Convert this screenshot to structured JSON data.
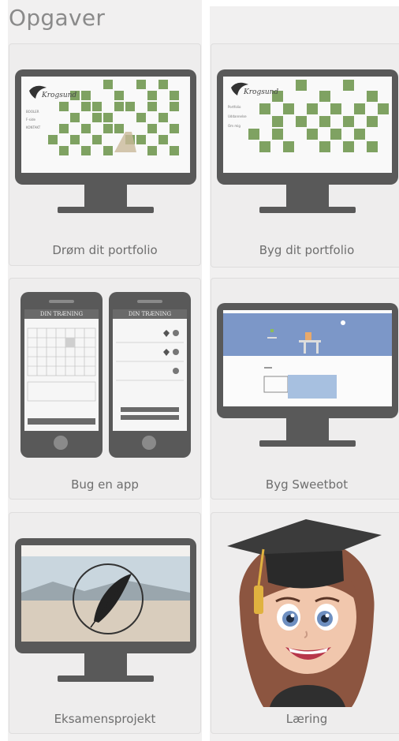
{
  "page": {
    "title": "Opgaver"
  },
  "cards": [
    {
      "label": "Drøm dit portfolio"
    },
    {
      "label": "Byg dit portfolio"
    },
    {
      "label": "Bug en app"
    },
    {
      "label": "Byg Sweetbot"
    },
    {
      "label": "Eksamensprojekt"
    },
    {
      "label": "Læring"
    }
  ],
  "thumbs": {
    "portfolio_logo": "Krogsund",
    "dream_menu": [
      "BOOLER",
      "F-side",
      "KONTAKT"
    ],
    "build_menu": [
      "Portfolio",
      "Uddannelse",
      "Om mig"
    ],
    "app_header": "DIN TRÆNING"
  },
  "colors": {
    "accent_blue": "#7c97c8",
    "device_gray": "#595959",
    "grass_green": "#7fa262"
  }
}
